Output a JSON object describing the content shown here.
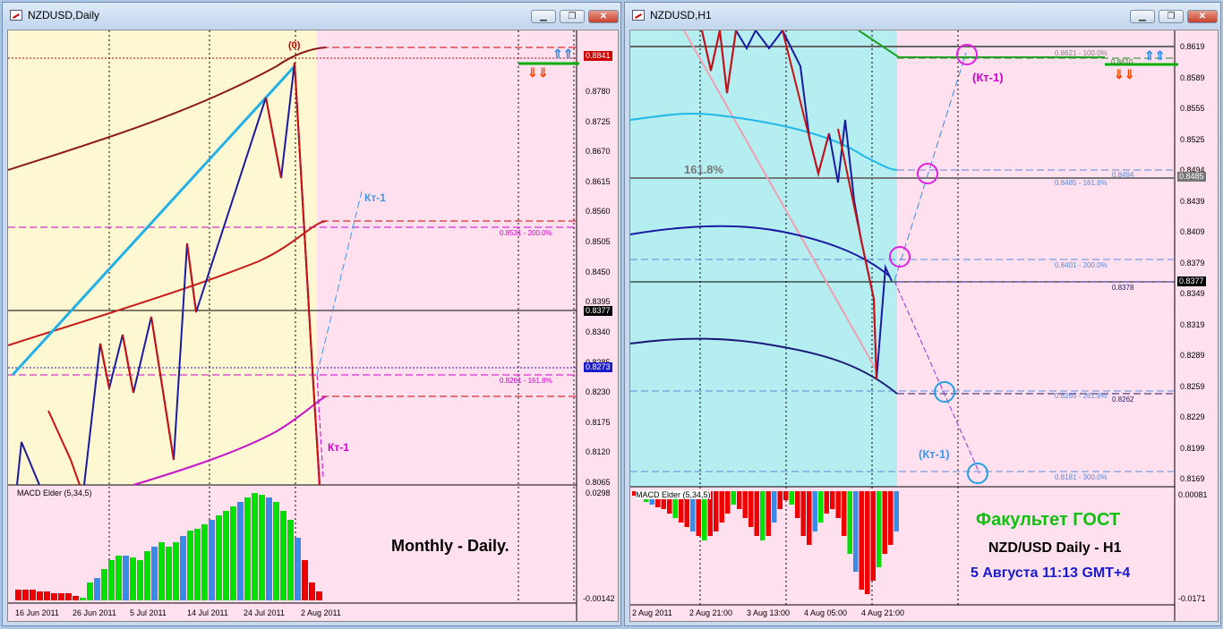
{
  "left": {
    "title": "NZDUSD,Daily",
    "price_ticks": [
      "0.8780",
      "0.8725",
      "0.8670",
      "0.8615",
      "0.8560",
      "0.8505",
      "0.8450",
      "0.8395",
      "0.8340",
      "0.8285",
      "0.8230",
      "0.8175",
      "0.8120",
      "0.8065"
    ],
    "price_tags": {
      "high": "0.8841",
      "current": "0.8377",
      "blue": "0.8273"
    },
    "top_marker": "(0)",
    "fib_200": "0.8531 - 200.0%",
    "fib_161": "0.8261 - 161.8%",
    "kt_blue": "Кт-1",
    "kt_magenta": "Кт-1",
    "macd_label": "MACD Elder (5,34,5)",
    "macd_max": "0.0298",
    "macd_min": "-0.00142",
    "monthly_text": "Monthly - Daily.",
    "time_labels": [
      "16 Jun 2011",
      "26 Jun 2011",
      "5 Jul 2011",
      "14 Jul 2011",
      "24 Jul 2011",
      "2 Aug 2011"
    ]
  },
  "right": {
    "title": "NZDUSD,H1",
    "price_ticks": [
      "0.8619",
      "0.8589",
      "0.8555",
      "0.8525",
      "0.8494",
      "0.8439",
      "0.8409",
      "0.8379",
      "0.8349",
      "0.8319",
      "0.8289",
      "0.8259",
      "0.8229",
      "0.8199",
      "0.8169"
    ],
    "price_tags": {
      "fib_161": "0.8485",
      "current": "0.8377"
    },
    "fib_100": "0.8621 - 100.0%",
    "fib_161": "0.8485 - 161.8%",
    "fib_200": "0.8401 - 200.0%",
    "fib_261": "0.8265 - 261.8%",
    "fib_300": "0.8181 - 300.0%",
    "level_8494": "0.8494",
    "level_8378": "0.8378",
    "level_8262": "0.8262",
    "level_8610": "0.8610",
    "pct_label": "161.8%",
    "kt_magenta": "(Кт-1)",
    "kt_blue": "(Кт-1)",
    "macd_label": "MACD Elder (5,34,5)",
    "macd_max": "0.00081",
    "macd_min": "-0.0171",
    "fakultet": "Факультет ГОСТ",
    "pair_text": "NZD/USD Daily - H1",
    "date_text": "5 Августа 11:13 GMT+4",
    "time_labels": [
      "2 Aug 2011",
      "2 Aug 21:00",
      "3 Aug 13:00",
      "4 Aug 05:00",
      "4 Aug 21:00"
    ]
  },
  "colors": {
    "accent_red": "#cc0000",
    "accent_blue": "#1a1aa0",
    "green": "#00a000"
  }
}
